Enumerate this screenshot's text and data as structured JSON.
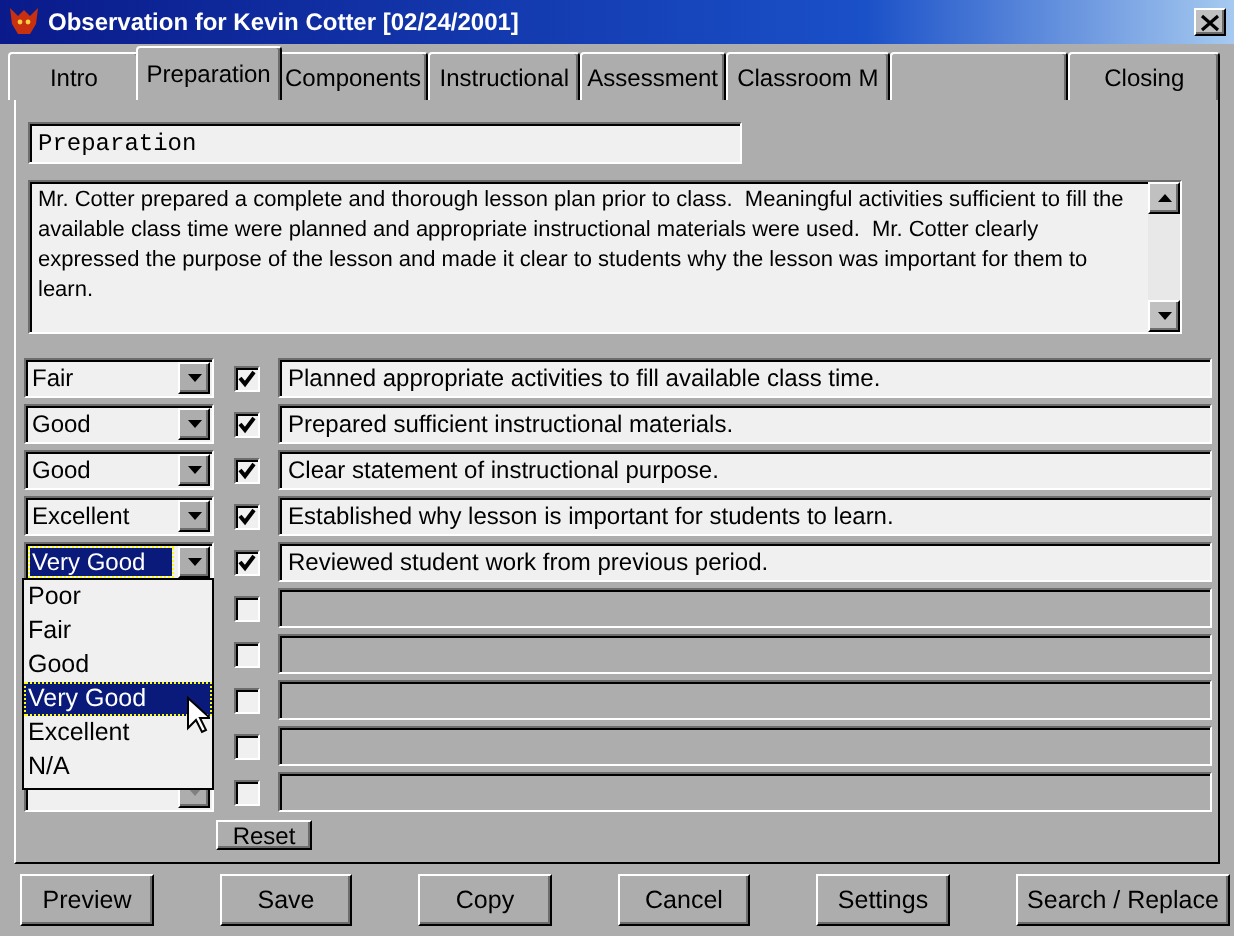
{
  "window": {
    "title": "Observation for Kevin Cotter  [02/24/2001]"
  },
  "tabs": [
    {
      "label": "Intro",
      "selected": false
    },
    {
      "label": "Preparation",
      "selected": true
    },
    {
      "label": "Components",
      "selected": false
    },
    {
      "label": "Instructional",
      "selected": false
    },
    {
      "label": "Assessment",
      "selected": false
    },
    {
      "label": "Classroom M",
      "selected": false
    },
    {
      "selected": false
    },
    {
      "label": "Closing",
      "selected": false
    }
  ],
  "section_name": "Preparation",
  "comments": "Mr. Cotter prepared a complete and thorough lesson plan prior to class.  Meaningful activities sufficient to fill the available class time were planned and appropriate instructional materials were used.  Mr. Cotter clearly expressed the purpose of the lesson and made it clear to students why the lesson was important for them to learn.",
  "criteria": [
    {
      "kind": "rated",
      "rating": "Fair",
      "checked": true,
      "text": "Planned appropriate activities to fill available class time.",
      "disabled": false
    },
    {
      "kind": "rated",
      "rating": "Good",
      "checked": true,
      "text": "Prepared sufficient instructional materials.",
      "disabled": false
    },
    {
      "kind": "rated",
      "rating": "Good",
      "checked": true,
      "text": "Clear statement of instructional purpose.",
      "disabled": false
    },
    {
      "kind": "rated",
      "rating": "Excellent",
      "checked": true,
      "text": "Established why lesson is important for students to learn.",
      "disabled": false
    },
    {
      "kind": "rated",
      "rating": "Very Good",
      "checked": true,
      "text": "Reviewed student work from previous period.",
      "disabled": false,
      "focused": true
    },
    {
      "kind": "covered",
      "checked": false,
      "disabled": true
    },
    {
      "kind": "covered",
      "checked": false,
      "disabled": true
    },
    {
      "kind": "covered",
      "checked": false,
      "disabled": true
    },
    {
      "kind": "covered",
      "checked": false,
      "disabled": true
    },
    {
      "kind": "partly_covered",
      "checked": false,
      "disabled": true
    }
  ],
  "rating_list": [
    {
      "label": "Poor",
      "selected": false
    },
    {
      "label": "Fair",
      "selected": false
    },
    {
      "label": "Good",
      "selected": false
    },
    {
      "label": "Very Good",
      "selected": true
    },
    {
      "label": "Excellent",
      "selected": false
    },
    {
      "label": "N/A",
      "selected": false
    }
  ],
  "reset_button": "Reset",
  "buttons": [
    "Preview",
    "Save",
    "Copy",
    "Cancel",
    "Settings",
    "Search / Replace"
  ]
}
